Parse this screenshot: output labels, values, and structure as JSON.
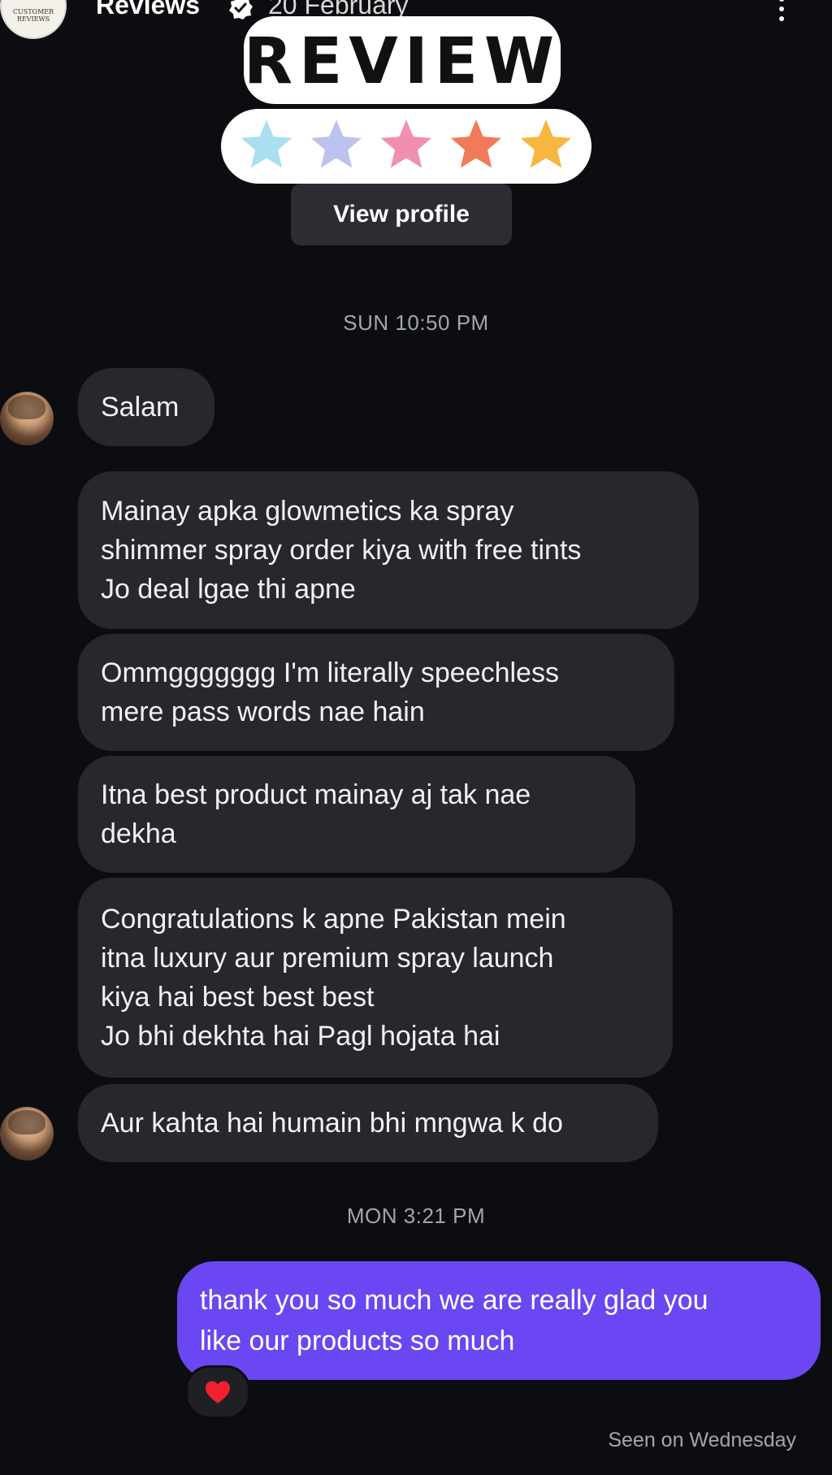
{
  "header": {
    "avatar_text": [
      "CUSTOMER",
      "REVIEWS"
    ],
    "name": "Reviews",
    "date": "20 February",
    "more_icon": "more-vertical-icon",
    "verified_icon": "verified-badge-icon"
  },
  "sticker": {
    "word": "REVIEW",
    "star_colors": [
      "#a9dff0",
      "#bcc3ee",
      "#f08fb1",
      "#f07a5a",
      "#f7b63d"
    ]
  },
  "profile": {
    "view_profile_label": "View profile"
  },
  "thread": {
    "timestamp_1": "SUN 10:50 PM",
    "timestamp_2": "MON 3:21 PM",
    "incoming": [
      {
        "lines": [
          "Salam"
        ]
      },
      {
        "lines": [
          "Mainay apka glowmetics ka spray",
          "shimmer spray order kiya with free tints",
          "Jo deal lgae thi apne"
        ]
      },
      {
        "lines": [
          "Ommggggggg I'm literally speechless",
          "mere pass words nae hain"
        ]
      },
      {
        "lines": [
          "Itna best product mainay aj tak nae",
          "dekha"
        ]
      },
      {
        "lines": [
          "Congratulations k apne Pakistan mein",
          "itna luxury aur premium spray launch",
          "kiya hai best best best",
          "Jo bhi dekhta hai Pagl hojata hai"
        ]
      },
      {
        "lines": [
          "Aur kahta hai humain bhi mngwa k do"
        ]
      }
    ],
    "outgoing": {
      "lines": [
        "thank you so much we are really glad you",
        "like our products so much"
      ],
      "reaction": "❤️"
    },
    "seen": "Seen on Wednesday"
  },
  "colors": {
    "background": "#0c0d10",
    "incoming_bubble": "#26282d",
    "outgoing_bubble": "#6a47f2",
    "timestamp_text": "#a3a6ac"
  }
}
